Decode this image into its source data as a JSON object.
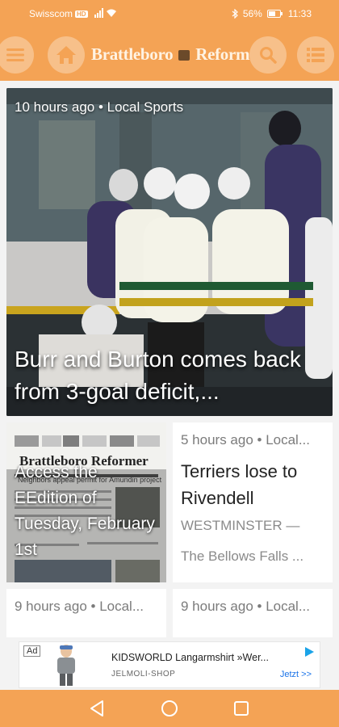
{
  "status_bar": {
    "carrier": "Swisscom",
    "network_badge": "HD",
    "battery": "56%",
    "time": "11:33"
  },
  "header": {
    "brand_left": "Brattleboro",
    "brand_right": "Reformer",
    "icons": [
      "menu-icon",
      "home-icon",
      "search-icon",
      "list-icon"
    ]
  },
  "hero": {
    "meta": "10 hours ago • Local Sports",
    "title": "Burr and Burton comes back from 3-goal deficit,..."
  },
  "edition_card": {
    "title": "Access the EEdition of Tuesday, February 1st",
    "masthead": "Brattleboro Reformer",
    "headline_fragment": "Neighbors appeal permit for Amundin project"
  },
  "terriers_card": {
    "meta": "5 hours ago • Local...",
    "title": "Terriers lose to Rivendell",
    "kicker": "WESTMINSTER —",
    "snippet": "The Bellows Falls ..."
  },
  "bottom_cards": [
    {
      "meta": "9 hours ago • Local..."
    },
    {
      "meta": "9 hours ago • Local..."
    }
  ],
  "ad": {
    "label": "Ad",
    "headline": "KIDSWORLD Langarmshirt »Wer...",
    "advertiser": "JELMOLI-SHOP",
    "cta": "Jetzt >>"
  },
  "colors": {
    "accent": "#f4a355",
    "accent_light": "#f7c08a"
  }
}
